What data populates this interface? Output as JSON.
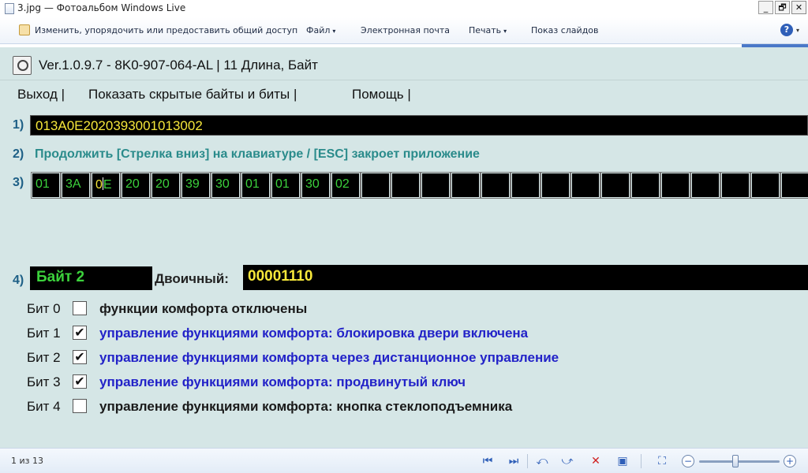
{
  "window": {
    "title": "3.jpg — Фотоальбом Windows Live",
    "minimize": "_",
    "maximize": "🗗",
    "close": "✕"
  },
  "menubar": {
    "share": "Изменить, упорядочить или предоставить общий доступ",
    "file": "Файл",
    "email": "Электронная почта",
    "print": "Печать",
    "slideshow": "Показ слайдов",
    "help_icon": "?",
    "dropdown_glyph": "▾"
  },
  "app": {
    "title": "Ver.1.0.9.7 -   8K0-907-064-AL | 11 Длина, Байт",
    "menu": [
      "Выход |",
      "Показать скрытые байты и биты |",
      "Помощь |"
    ],
    "line1_no": "1)",
    "line2_no": "2)",
    "line3_no": "3)",
    "line4_no": "4)",
    "coding_string": "013A0E2020393001013002",
    "hint": "Продолжить [Стрелка вниз] на клавиатуре / [ESC] закроет приложение",
    "bytes": [
      "01",
      "3A",
      "0E",
      "20",
      "20",
      "39",
      "30",
      "01",
      "01",
      "30",
      "02",
      "",
      "",
      "",
      "",
      "",
      "",
      "",
      "",
      "",
      "",
      "",
      "",
      "",
      "",
      ""
    ],
    "selected_byte_first": "0",
    "selected_byte_second": "E",
    "byte_label": "Байт 2",
    "binary_label": "Двоичный:",
    "binary_value": "00001110",
    "bits": [
      {
        "label": "Бит 0",
        "checked": false,
        "mark": "",
        "text": "функции комфорта отключены"
      },
      {
        "label": "Бит 1",
        "checked": true,
        "mark": "✔",
        "text": "управление функциями комфорта: блокировка двери включена"
      },
      {
        "label": "Бит 2",
        "checked": true,
        "mark": "✔",
        "text": "управление функциями комфорта через дистанционное управление"
      },
      {
        "label": "Бит 3",
        "checked": true,
        "mark": "✔",
        "text": "управление функциями комфорта: продвинутый ключ"
      },
      {
        "label": "Бит 4",
        "checked": false,
        "mark": "",
        "text": "управление функциями комфорта: кнопка стеклоподъемника"
      }
    ]
  },
  "status": {
    "counter": "1 из 13",
    "zoom_minus": "−",
    "zoom_plus": "+",
    "zoom_level": 0.45,
    "controls": {
      "prev": "⏮",
      "next": "⏭",
      "rotate_left": "⤺",
      "rotate_right": "⤻",
      "delete": "✕",
      "slideshow": "▣",
      "fit": "⛶"
    }
  },
  "colors": {
    "app_bg": "#d5e6e6",
    "hex_text": "#f6e73a",
    "byte_green": "#3cd23c",
    "bit_on_blue": "#2222c8",
    "line_number": "#1d5f86"
  }
}
